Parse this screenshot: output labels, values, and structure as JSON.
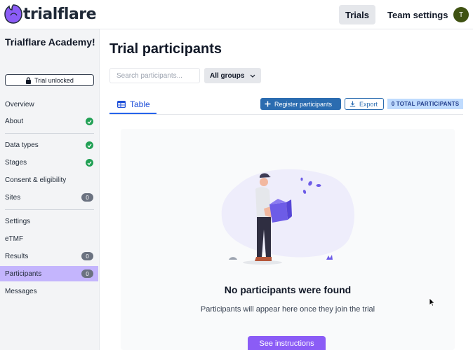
{
  "app": {
    "name": "trialflare"
  },
  "topnav": {
    "trials": "Trials",
    "team_settings": "Team settings",
    "avatar_initial": "T"
  },
  "sidebar": {
    "org_name": "Trialflare Academy!",
    "trial_status": "Trial unlocked",
    "items": [
      {
        "label": "Overview"
      },
      {
        "label": "About",
        "status": "complete"
      },
      {
        "label": "Data types",
        "status": "complete"
      },
      {
        "label": "Stages",
        "status": "complete"
      },
      {
        "label": "Consent & eligibility"
      },
      {
        "label": "Sites",
        "count": "0"
      },
      {
        "label": "Settings"
      },
      {
        "label": "eTMF"
      },
      {
        "label": "Results",
        "count": "0"
      },
      {
        "label": "Participants",
        "count": "0",
        "active": true
      },
      {
        "label": "Messages"
      }
    ]
  },
  "main": {
    "title": "Trial participants",
    "search_placeholder": "Search participants...",
    "group_filter": "All groups",
    "tab_table": "Table",
    "register_button": "Register participants",
    "export_button": "Export",
    "total_count": "0 TOTAL PARTICIPANTS",
    "empty_state": {
      "title": "No participants were found",
      "subtitle": "Participants will appear here once they join the trial",
      "button": "See instructions"
    }
  },
  "colors": {
    "accent": "#8b5cf6",
    "primary_button": "#2b6cb0",
    "active_sidebar": "#c4b5fd",
    "success": "#22a055"
  },
  "icons": [
    "logo-icon",
    "lock-icon",
    "check-icon",
    "table-icon",
    "plus-icon",
    "download-icon",
    "chevron-down-icon",
    "cursor-icon"
  ]
}
